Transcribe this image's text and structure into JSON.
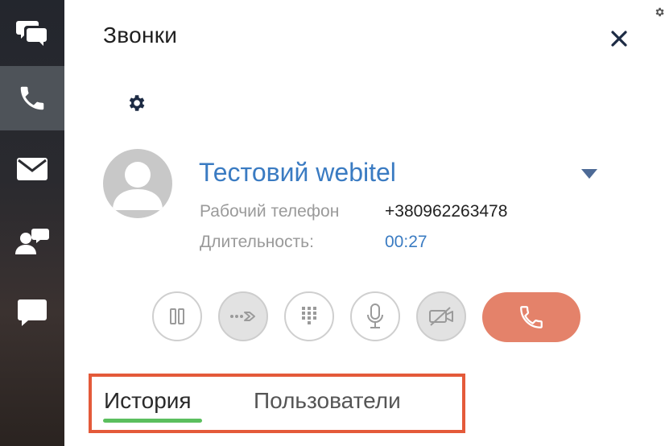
{
  "panel": {
    "title": "Звонки"
  },
  "rail": {
    "items": [
      {
        "icon": "chats-icon",
        "active": false
      },
      {
        "icon": "phone-icon",
        "active": true
      },
      {
        "icon": "mail-icon",
        "active": false
      },
      {
        "icon": "contact-chat-icon",
        "active": false
      },
      {
        "icon": "message-icon",
        "active": false
      }
    ]
  },
  "call": {
    "caller_name": "Тестовий webitel",
    "phone_label": "Рабочий телефон",
    "phone_value": "+380962263478",
    "duration_label": "Длительность:",
    "duration_value": "00:27"
  },
  "controls": [
    "pause-icon",
    "transfer-icon",
    "keypad-icon",
    "microphone-icon",
    "video-off-icon",
    "hangup-icon"
  ],
  "tabs": [
    {
      "label": "История",
      "active": true
    },
    {
      "label": "Пользователи",
      "active": false
    }
  ],
  "colors": {
    "accent_blue": "#3a7bc2",
    "hangup": "#e4826a",
    "tab_underline": "#5bbf5e",
    "highlight_box": "#e45a3a"
  }
}
